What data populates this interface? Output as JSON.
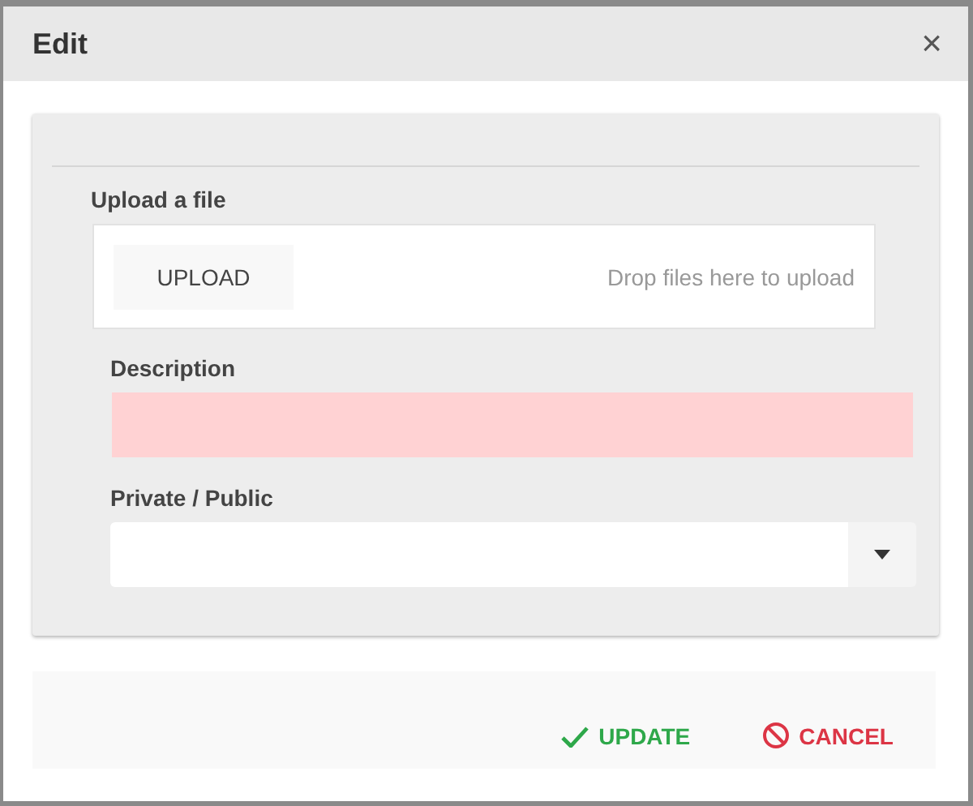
{
  "dialog": {
    "title": "Edit",
    "close": "×"
  },
  "upload": {
    "label": "Upload a file",
    "button": "UPLOAD",
    "hint": "Drop files here to upload"
  },
  "description": {
    "label": "Description",
    "invalid": true
  },
  "visibility": {
    "label": "Private / Public"
  },
  "buttons": [
    {
      "kind": "confirm",
      "label": "UPDATE"
    },
    {
      "kind": "cancel",
      "label": "CANCEL"
    }
  ]
}
